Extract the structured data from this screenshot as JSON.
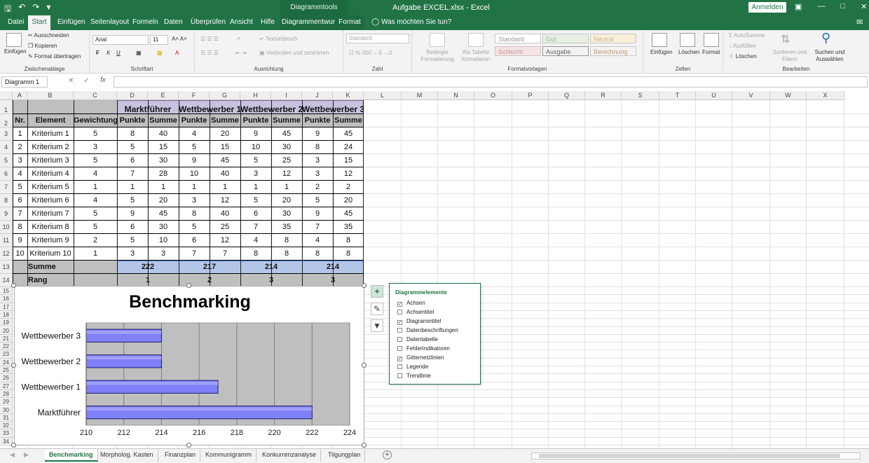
{
  "window": {
    "title": "Aufgabe EXCEL.xlsx  -  Excel",
    "tools_label": "Diagrammtools",
    "signin": "Anmelden"
  },
  "tabs": [
    "Datei",
    "Start",
    "Einfügen",
    "Seitenlayout",
    "Formeln",
    "Daten",
    "Überprüfen",
    "Ansicht",
    "Hilfe",
    "Diagrammentwurf",
    "Format"
  ],
  "tell_me": "Was möchten Sie tun?",
  "ribbon": {
    "clipboard": {
      "paste": "Einfügen",
      "cut": "Ausschneiden",
      "copy": "Kopieren",
      "format_painter": "Format übertragen",
      "label": "Zwischenablage"
    },
    "font": {
      "name": "Arial",
      "size": "11",
      "label": "Schriftart",
      "bold": "F",
      "italic": "K",
      "underline": "U"
    },
    "alignment": {
      "wrap": "Textumbruch",
      "merge": "Verbinden und zentrieren",
      "label": "Ausrichtung"
    },
    "number": {
      "format": "Standard",
      "label": "Zahl"
    },
    "styles": {
      "cond": "Bedingte Formatierung",
      "table": "Als Tabelle formatieren",
      "s1": "Standard",
      "s2": "Gut",
      "s3": "Neutral",
      "s4": "Schlecht",
      "s5": "Ausgabe",
      "s6": "Berechnung",
      "label": "Formatvorlagen"
    },
    "cells": {
      "insert": "Einfügen",
      "delete": "Löschen",
      "format": "Format",
      "label": "Zellen"
    },
    "editing": {
      "autosum": "AutoSumme",
      "fill": "Ausfüllen",
      "clear": "Löschen",
      "sort": "Sortieren und Filtern",
      "find": "Suchen und Auswählen",
      "label": "Bearbeiten"
    }
  },
  "namebox": "Diagramm 1",
  "columns": [
    "A",
    "B",
    "C",
    "D",
    "E",
    "F",
    "G",
    "H",
    "I",
    "J",
    "K",
    "L",
    "M",
    "N",
    "O",
    "P",
    "Q",
    "R",
    "S",
    "T",
    "U",
    "V",
    "W",
    "X"
  ],
  "table": {
    "groups": [
      "Marktführer",
      "Wettbewerber 1",
      "Wettbewerber 2",
      "Wettbewerber 3"
    ],
    "headers": [
      "Nr.",
      "Element",
      "Gewichtung",
      "Punkte",
      "Summe",
      "Punkte",
      "Summe",
      "Punkte",
      "Summe",
      "Punkte",
      "Summe"
    ],
    "rows": [
      [
        "1",
        "Kriterium 1",
        "5",
        "8",
        "40",
        "4",
        "20",
        "9",
        "45",
        "9",
        "45"
      ],
      [
        "2",
        "Kriterium 2",
        "3",
        "5",
        "15",
        "5",
        "15",
        "10",
        "30",
        "8",
        "24"
      ],
      [
        "3",
        "Kriterium 3",
        "5",
        "6",
        "30",
        "9",
        "45",
        "5",
        "25",
        "3",
        "15"
      ],
      [
        "4",
        "Kriterium 4",
        "4",
        "7",
        "28",
        "10",
        "40",
        "3",
        "12",
        "3",
        "12"
      ],
      [
        "5",
        "Kriterium 5",
        "1",
        "1",
        "1",
        "1",
        "1",
        "1",
        "1",
        "2",
        "2"
      ],
      [
        "6",
        "Kriterium 6",
        "4",
        "5",
        "20",
        "3",
        "12",
        "5",
        "20",
        "5",
        "20"
      ],
      [
        "7",
        "Kriterium 7",
        "5",
        "9",
        "45",
        "8",
        "40",
        "6",
        "30",
        "9",
        "45"
      ],
      [
        "8",
        "Kriterium 8",
        "5",
        "6",
        "30",
        "5",
        "25",
        "7",
        "35",
        "7",
        "35"
      ],
      [
        "9",
        "Kriterium 9",
        "2",
        "5",
        "10",
        "6",
        "12",
        "4",
        "8",
        "4",
        "8"
      ],
      [
        "10",
        "Kriterium 10",
        "1",
        "3",
        "3",
        "7",
        "7",
        "8",
        "8",
        "8",
        "8"
      ]
    ],
    "sum_label": "Summe",
    "sums": [
      "222",
      "217",
      "214",
      "214"
    ],
    "rank_label": "Rang",
    "ranks": [
      "1",
      "2",
      "3",
      "3"
    ]
  },
  "chart_data": {
    "type": "bar",
    "orientation": "horizontal",
    "title": "Benchmarking",
    "categories": [
      "Marktführer",
      "Wettbewerber 1",
      "Wettbewerber 2",
      "Wettbewerber 3"
    ],
    "values": [
      222,
      217,
      214,
      214
    ],
    "xlim": [
      210,
      224
    ],
    "ticks": [
      "210",
      "212",
      "214",
      "216",
      "218",
      "220",
      "222",
      "224"
    ],
    "grid": true,
    "bar_color": "#8080f8"
  },
  "chart_elements": {
    "title": "Diagrammelemente",
    "items": [
      {
        "label": "Achsen",
        "checked": true
      },
      {
        "label": "Achsentitel",
        "checked": false
      },
      {
        "label": "Diagrammtitel",
        "checked": true
      },
      {
        "label": "Datenbeschriftungen",
        "checked": false
      },
      {
        "label": "Datentabelle",
        "checked": false
      },
      {
        "label": "Fehlerindikatoren",
        "checked": false
      },
      {
        "label": "Gitternetzlinien",
        "checked": true
      },
      {
        "label": "Legende",
        "checked": false
      },
      {
        "label": "Trendlinie",
        "checked": false
      }
    ]
  },
  "sheets": [
    "Benchmarking",
    "Morpholog. Kasten",
    "Finanzplan",
    "Kommunigramm",
    "Konkurrenzanalyse",
    "Tilgungplan"
  ],
  "colors": {
    "excel_green": "#217346",
    "header_gray": "#bfbfbf",
    "selection_blue": "#b4c6e7"
  }
}
